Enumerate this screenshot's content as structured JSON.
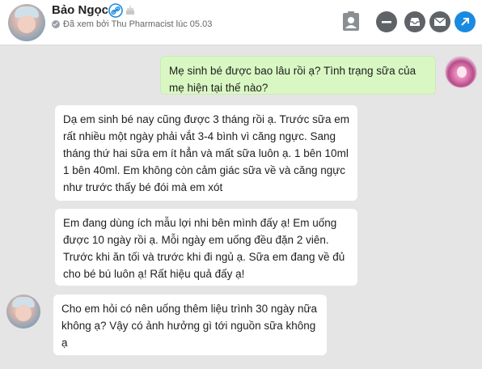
{
  "header": {
    "contact_name": "Bảo Ngọc",
    "seen_status": "Đã xem bởi Thu Pharmacist lúc 05.03",
    "icons": {
      "verified": "link-badge-icon",
      "birthday": "cake-icon",
      "profile": "contact-card-icon",
      "minimize": "minus-icon",
      "inbox": "inbox-icon",
      "mail": "mail-icon",
      "open": "open-external-icon"
    },
    "colors": {
      "verified": "#1a8ae0",
      "open_button": "#1a8ae0",
      "action_buttons": "#5f6368"
    }
  },
  "messages": [
    {
      "direction": "outgoing",
      "text": "Mẹ sinh bé được bao lâu rồi ạ? Tình trạng sữa của mẹ hiện tại thế nào?"
    },
    {
      "direction": "incoming",
      "text": "Dạ em sinh bé nay cũng được 3 tháng rồi ạ. Trước sữa em rất nhiều một ngày phải vắt 3-4 bình vì căng ngực. Sang tháng thứ hai sữa em ít hẳn và mất sữa luôn ạ. 1 bên 10ml 1 bên 40ml. Em không còn cảm giác sữa về và căng ngực như trước thấy bé đói mà em xót"
    },
    {
      "direction": "incoming",
      "text": "Em đang dùng ích mẫu lợi nhi bên mình đấy ạ! Em uống được 10 ngày rồi ạ. Mỗi ngày em uống đều đặn 2 viên. Trước khi ăn tối và trước khi đi ngủ ạ. Sữa em đang về đủ cho bé bú luôn ạ! Rất hiệu quả đấy ạ!"
    },
    {
      "direction": "incoming",
      "text": "Cho em hỏi có nên uống thêm liệu trình 30 ngày nữa không ạ? Vậy có ảnh hưởng gì tới nguồn sữa không ạ"
    }
  ],
  "colors": {
    "background": "#e5e5e5",
    "outgoing_bubble": "#d9f7c3",
    "incoming_bubble": "#ffffff"
  }
}
